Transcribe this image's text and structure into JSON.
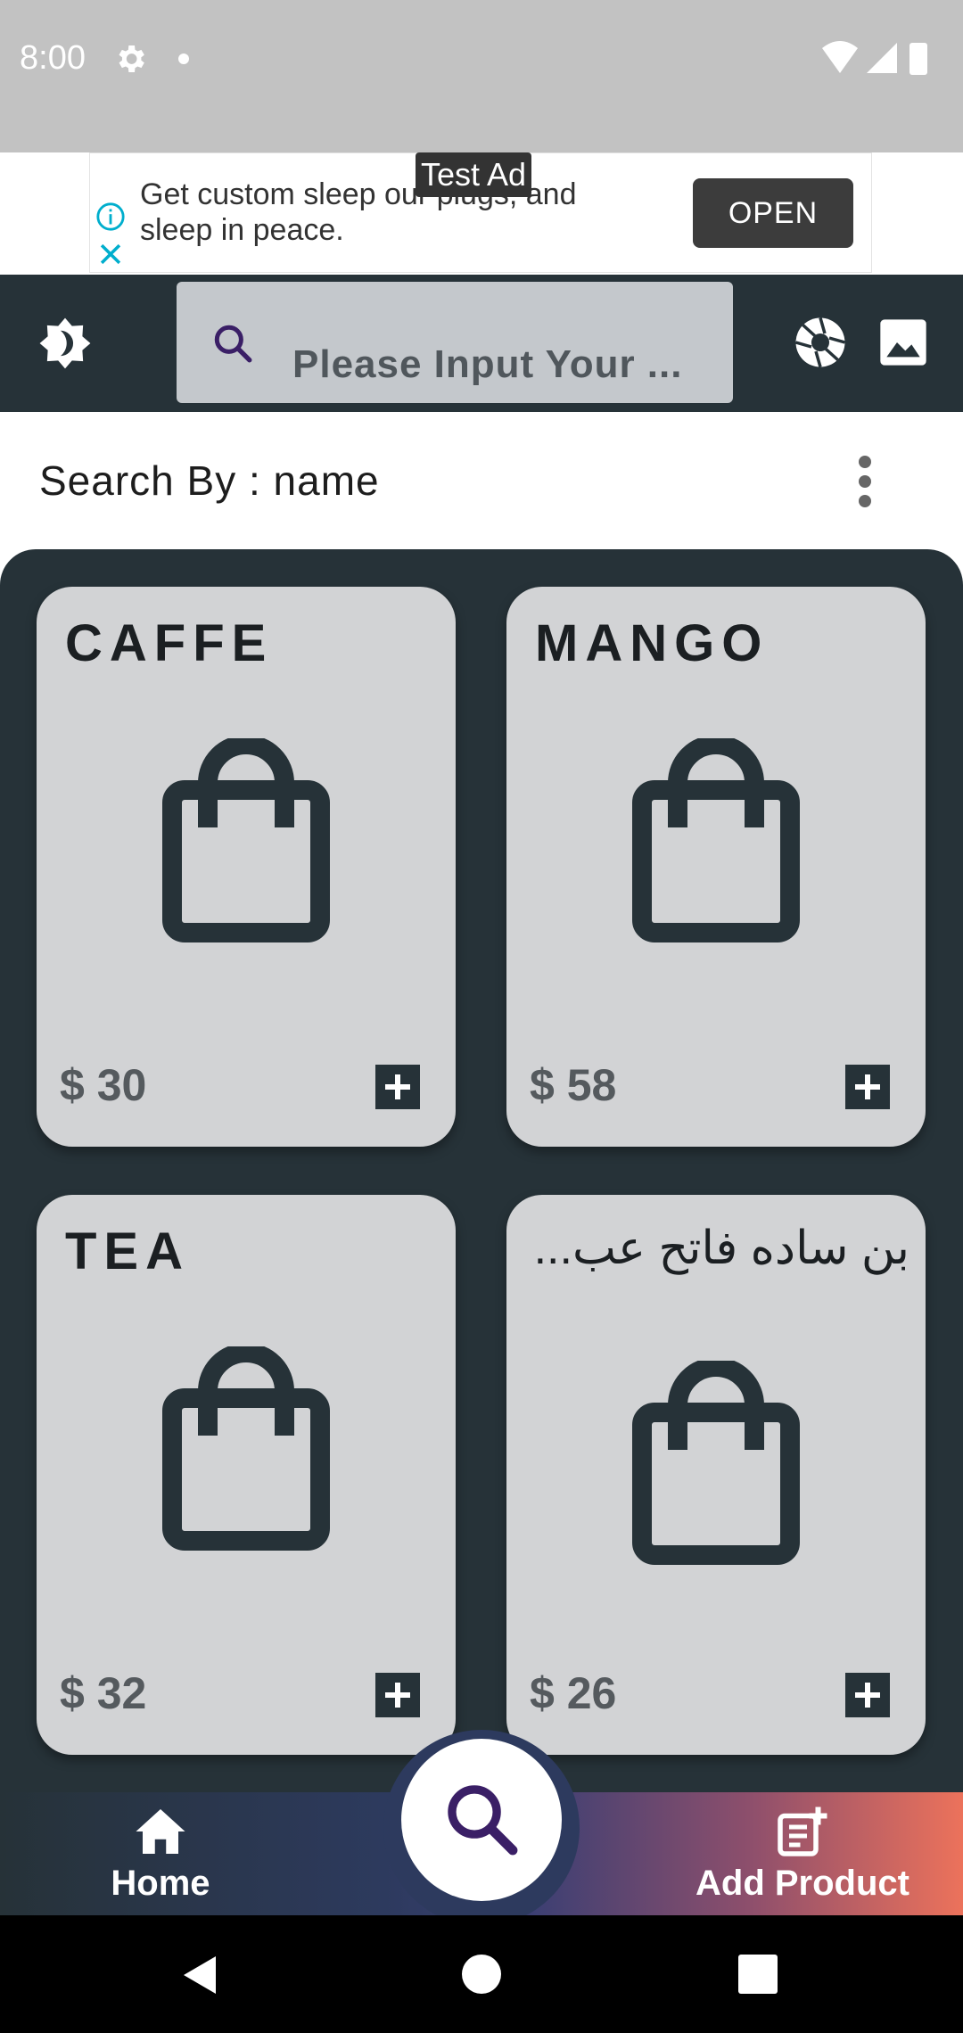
{
  "status_bar": {
    "time": "8:00"
  },
  "ad": {
    "tag": "Test Ad",
    "text": "Get custom sleep our plugs, and sleep in peace.",
    "open_label": "OPEN"
  },
  "toolbar": {
    "search_placeholder": "Please Input Your ..."
  },
  "search_by": {
    "label": "Search By : name"
  },
  "products": [
    {
      "name": "CAFFE",
      "price": "$ 30"
    },
    {
      "name": "MANGO",
      "price": "$ 58"
    },
    {
      "name": "TEA",
      "price": "$ 32"
    },
    {
      "name": "بن ساده فاتح عب...",
      "price": "$ 26"
    }
  ],
  "bottom_nav": {
    "home_label": "Home",
    "add_product_label": "Add Product"
  },
  "colors": {
    "toolbar": "#263238",
    "card": "#d2d3d5",
    "gradient_end": "#ec725b"
  },
  "icons": [
    "gear-icon",
    "wifi-icon",
    "signal-icon",
    "battery-icon",
    "info-icon",
    "close-icon",
    "theme-icon",
    "search-icon",
    "camera-shutter-icon",
    "gallery-icon",
    "more-vertical-icon",
    "shopping-bag-icon",
    "add-icon",
    "home-icon",
    "add-product-icon"
  ]
}
